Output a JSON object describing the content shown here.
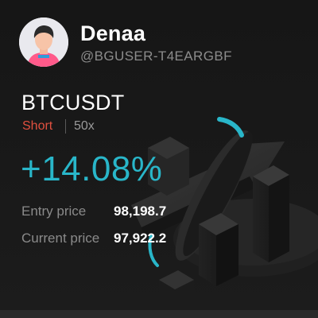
{
  "user": {
    "name": "Denaa",
    "handle": "@BGUSER-T4EARGBF"
  },
  "position": {
    "symbol": "BTCUSDT",
    "direction": "Short",
    "leverage": "50x",
    "pnl_percent": "+14.08%"
  },
  "prices": {
    "entry_label": "Entry price",
    "entry_value": "98,198.7",
    "current_label": "Current price",
    "current_value": "97,922.2"
  },
  "colors": {
    "accent": "#29b6c9",
    "short": "#e0503f",
    "background": "#161616"
  },
  "icons": {
    "avatar": "user-avatar",
    "decoration": "chart-arrow-illustration"
  }
}
